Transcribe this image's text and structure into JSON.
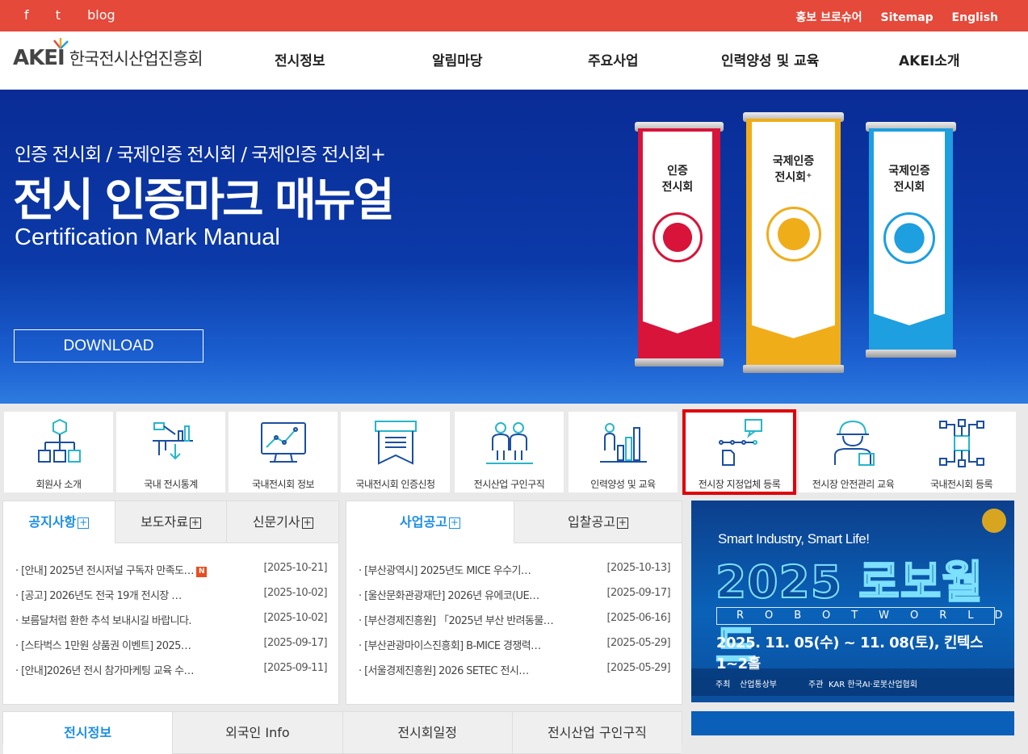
{
  "topbar": {
    "social": [
      "f",
      "t",
      "blog"
    ],
    "util": [
      "홍보 브로슈어",
      "Sitemap",
      "English"
    ]
  },
  "header": {
    "logo_text": "AKEI",
    "logo_name": "한국전시산업진흥회",
    "nav": [
      "전시정보",
      "알림마당",
      "주요사업",
      "인력양성 및 교육",
      "AKEI소개"
    ]
  },
  "hero": {
    "subtitle": "인증 전시회 / 국제인증 전시회 / 국제인증 전시회+",
    "title": "전시 인증마크 매뉴얼",
    "english": "Certification Mark Manual",
    "download": "DOWNLOAD",
    "banners": [
      {
        "line1": "인증",
        "line2": "전시회",
        "color": "#d8143a"
      },
      {
        "line1": "국제인증",
        "line2": "전시회⁺",
        "color": "#f0ad1a"
      },
      {
        "line1": "국제인증",
        "line2": "전시회",
        "color": "#1d9fe0"
      }
    ]
  },
  "quick": [
    {
      "label": "회원사 소개",
      "icon": "member-company-icon"
    },
    {
      "label": "국내 전시통계",
      "icon": "statistics-icon"
    },
    {
      "label": "국내전시회 정보",
      "icon": "monitor-chart-icon"
    },
    {
      "label": "국내전시회 인증신청",
      "icon": "certificate-icon"
    },
    {
      "label": "전시산업 구인구직",
      "icon": "job-people-icon"
    },
    {
      "label": "인력양성 및 교육",
      "icon": "growth-chart-icon"
    },
    {
      "label": "전시장 지정업체 등록",
      "icon": "flow-chat-icon"
    },
    {
      "label": "전시장 안전관리 교육",
      "icon": "safety-worker-icon"
    },
    {
      "label": "국내전시회 등록",
      "icon": "network-chip-icon"
    }
  ],
  "notice": {
    "tabs": [
      "공지사항",
      "보도자료",
      "신문기사"
    ],
    "items": [
      {
        "title": "· [안내] 2025년 전시저널 구독자 만족도…",
        "date": "[2025-10-21]",
        "new": "N"
      },
      {
        "title": "· [공고] 2026년도 전국 19개 전시장 …",
        "date": "[2025-10-02]"
      },
      {
        "title": "· 보름달처럼 환한 추석 보내시길 바랍니다.",
        "date": "[2025-10-02]"
      },
      {
        "title": "· [스타벅스 1만원 상품권 이벤트] 2025…",
        "date": "[2025-09-17]"
      },
      {
        "title": "· [안내]2026년 전시 참가마케팅 교육 수…",
        "date": "[2025-09-11]"
      }
    ]
  },
  "business": {
    "tabs": [
      "사업공고",
      "입찰공고"
    ],
    "items": [
      {
        "title": "· [부산광역시] 2025년도 MICE 우수기…",
        "date": "[2025-10-13]"
      },
      {
        "title": "· [울산문화관광재단] 2026년 유에코(UE…",
        "date": "[2025-09-17]"
      },
      {
        "title": "· [부산경제진흥원] 「2025년 부산 반려동물…",
        "date": "[2025-06-16]"
      },
      {
        "title": "· [부산관광마이스진흥회] B-MICE 경쟁력…",
        "date": "[2025-05-29]"
      },
      {
        "title": "· [서울경제진흥원] 2026 SETEC 전시…",
        "date": "[2025-05-29]"
      }
    ]
  },
  "lower_tabs": [
    "전시정보",
    "외국인 Info",
    "전시회일정",
    "전시산업 구인구직"
  ],
  "ad": {
    "tagline": "Smart Industry, Smart Life!",
    "title": "2025 로보월드",
    "roboworld": "ROBOTWORLD",
    "date": "2025. 11. 05(수) ~ 11. 08(토), 킨텍스 1~2홀",
    "host_label": "주최",
    "host": "산업통상부",
    "org_label": "주관",
    "org": "KAR 한국AI·로봇산업협회"
  },
  "colors": {
    "brand_red": "#e4493a",
    "accent_blue": "#1a8ee6",
    "highlight": "#e0000b"
  }
}
